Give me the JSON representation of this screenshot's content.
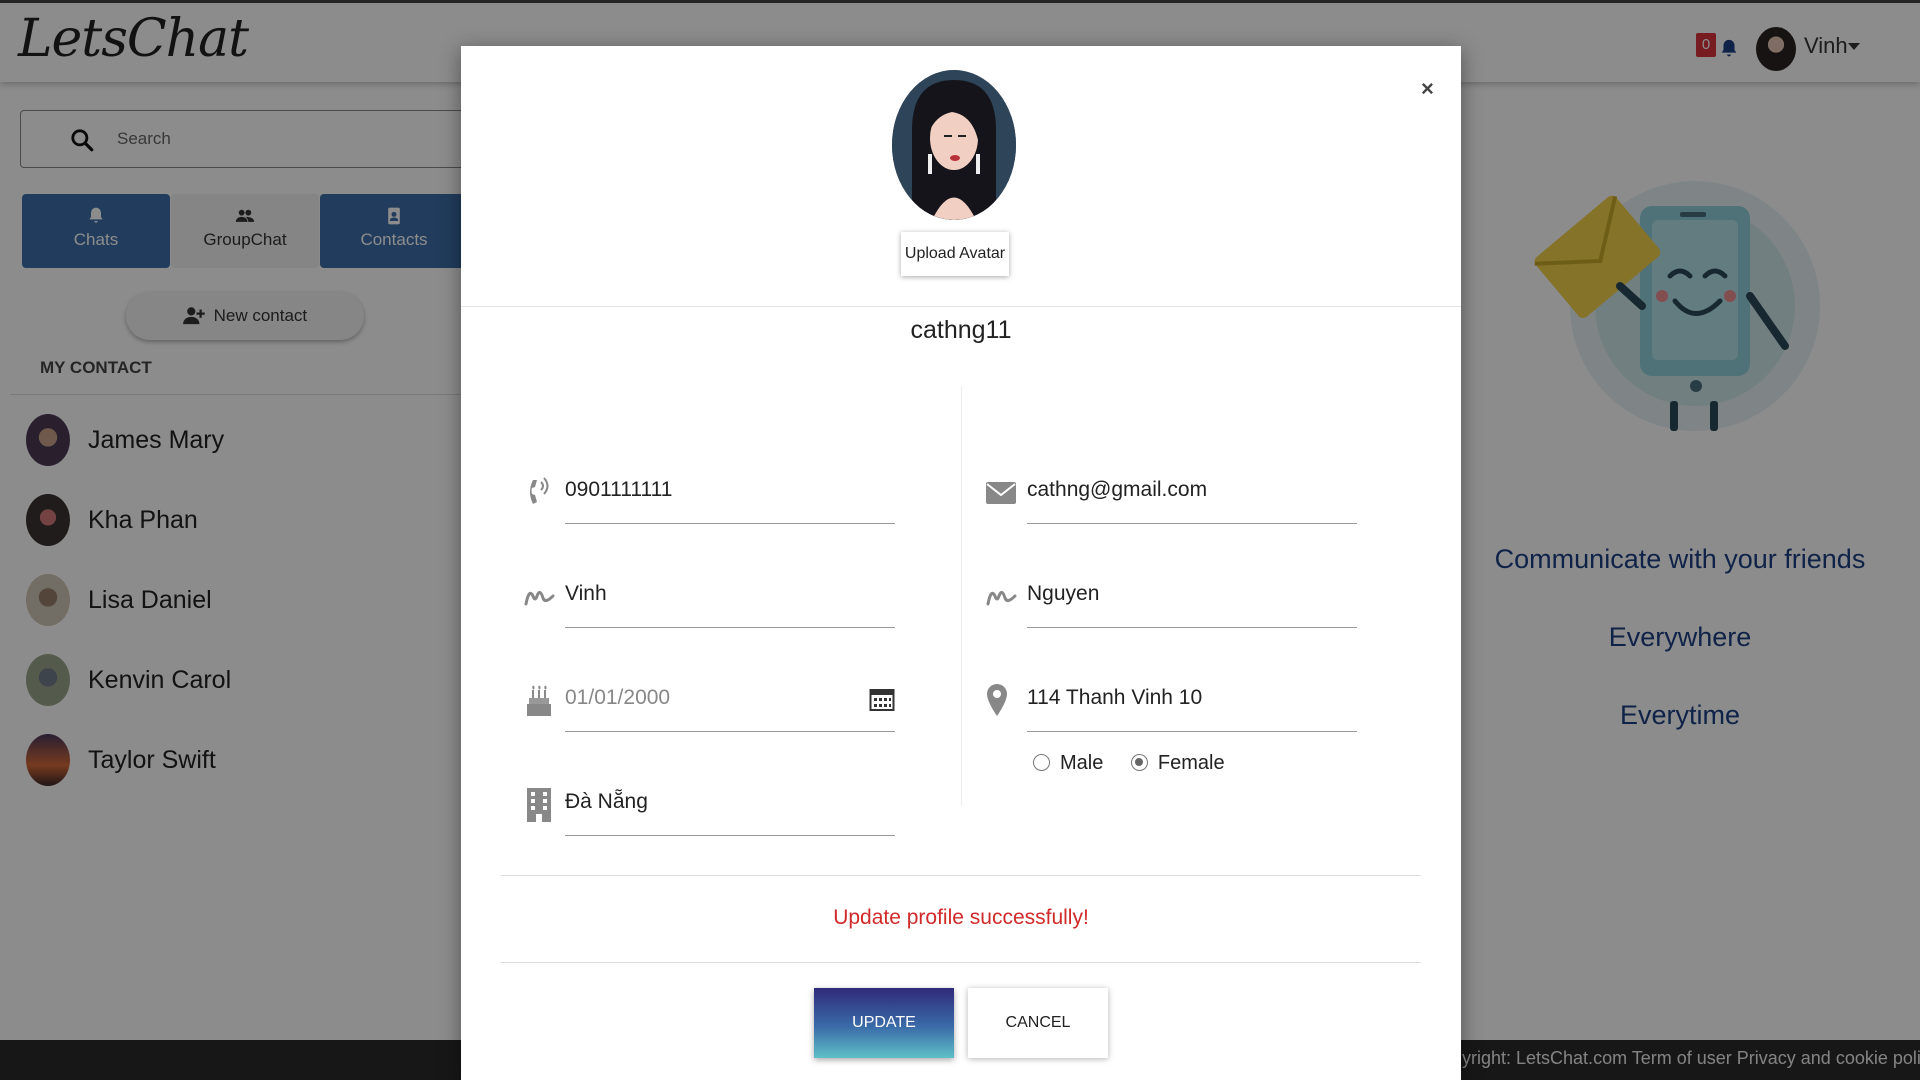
{
  "app": {
    "logo": "LetsChat"
  },
  "header": {
    "notification_count": "0",
    "user_name": "Vinh",
    "icons": [
      "bell-icon",
      "chevron-down-icon"
    ]
  },
  "sidebar": {
    "search_placeholder": "Search",
    "tabs": [
      {
        "label": "Chats",
        "icon": "bell-icon",
        "active": true
      },
      {
        "label": "GroupChat",
        "icon": "users-icon",
        "active": false
      },
      {
        "label": "Contacts",
        "icon": "contact-book-icon",
        "active": true
      }
    ],
    "new_contact_label": "New contact",
    "section_title": "MY CONTACT",
    "contacts": [
      {
        "name": "James Mary"
      },
      {
        "name": "Kha Phan"
      },
      {
        "name": "Lisa Daniel"
      },
      {
        "name": "Kenvin Carol"
      },
      {
        "name": "Taylor Swift"
      }
    ]
  },
  "right_panel": {
    "lines": [
      "Communicate with your friends",
      "Everywhere",
      "Everytime"
    ]
  },
  "footer": {
    "text": "yright: LetsChat.com Term of user Privacy and cookie policy"
  },
  "modal": {
    "close_label": "×",
    "upload_avatar_label": "Upload Avatar",
    "username": "cathng11",
    "fields": {
      "phone": {
        "value": "0901111111",
        "icon": "phone-icon"
      },
      "email": {
        "value": "cathng@gmail.com",
        "icon": "envelope-icon"
      },
      "first_name": {
        "value": "Vinh",
        "icon": "signature-icon"
      },
      "last_name": {
        "value": "Nguyen",
        "icon": "signature-icon"
      },
      "birthday": {
        "value": "01/01/2000",
        "icon": "birthday-cake-icon"
      },
      "address": {
        "value": "114 Thanh Vinh 10",
        "icon": "map-marker-icon"
      },
      "city": {
        "value": "Đà Nẵng",
        "icon": "building-icon"
      }
    },
    "gender": {
      "options": [
        "Male",
        "Female"
      ],
      "selected": "Female"
    },
    "status_message": "Update profile successfully!",
    "update_label": "UPDATE",
    "cancel_label": "CANCEL"
  },
  "colors": {
    "accent_tab": "#3d6ea8",
    "tagline": "#1d3f84",
    "status_error": "#d12a2a",
    "badge": "#d9363e"
  }
}
